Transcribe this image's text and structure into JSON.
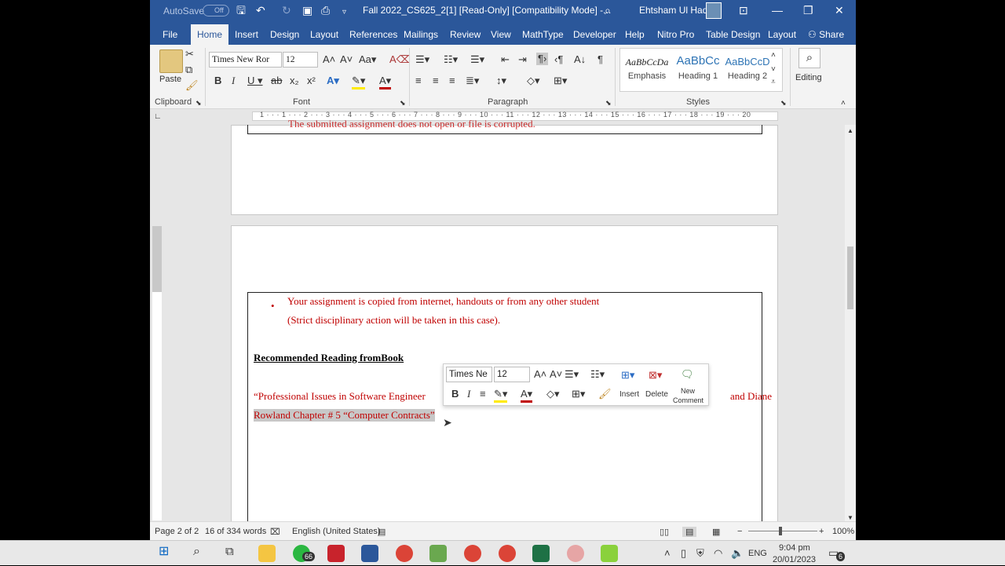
{
  "titlebar": {
    "autosave": "AutoSave",
    "autosave_state": "Off",
    "doc_title": "Fall 2022_CS625_2[1] [Read-Only] [Compatibility Mode] -...",
    "user": "Ehtsham Ul Haq"
  },
  "tabs": [
    "File",
    "Home",
    "Insert",
    "Design",
    "Layout",
    "References",
    "Mailings",
    "Review",
    "View",
    "MathType",
    "Developer",
    "Help",
    "Nitro Pro",
    "Table Design",
    "Layout"
  ],
  "share": "Share",
  "ribbon": {
    "paste": "Paste",
    "font_name": "Times New Ror",
    "font_size": "12",
    "groups": {
      "clipboard": "Clipboard",
      "font": "Font",
      "paragraph": "Paragraph",
      "styles": "Styles"
    },
    "styles": [
      {
        "sample": "AaBbCcDa",
        "label": "Emphasis"
      },
      {
        "sample": "AaBbCc",
        "label": "Heading 1"
      },
      {
        "sample": "AaBbCcD",
        "label": "Heading 2"
      }
    ],
    "editing": "Editing"
  },
  "ruler": {
    "numbers": "1 · · · 1 · · · 2 · · · 3 · · · 4 · · · 5 · · · 6 · · · 7 · · · 8 · · · 9 · · · 10 · · · 11 · · · 12 · · · 13 · · · 14 · · · 15 · · · 16 · · · 17 · · · 18 · · · 19 · · · 20"
  },
  "document": {
    "cut_line": "The submitted assignment does not open or file is corrupted.",
    "bullet_line1": "Your assignment is copied from internet, handouts or from any other student",
    "bullet_line2": "(Strict disciplinary action will be taken in this case).",
    "heading": "Recommended Reading fromBook",
    "ref_line1_start": "“Professional Issues in Software Engineer",
    "ref_line1_end": "and Diane",
    "ref_line2": "Rowland Chapter # 5 “Computer Contracts”"
  },
  "mini_toolbar": {
    "font": "Times Ne",
    "size": "12",
    "insert": "Insert",
    "delete": "Delete",
    "new_comment_1": "New",
    "new_comment_2": "Comment"
  },
  "status": {
    "page": "Page 2 of 2",
    "words": "16 of 334 words",
    "language": "English (United States)",
    "zoom": "100%"
  },
  "taskbar": {
    "whatsapp_badge": "66",
    "lang": "ENG",
    "time": "9:04 pm",
    "date": "20/01/2023",
    "notif": "6"
  }
}
